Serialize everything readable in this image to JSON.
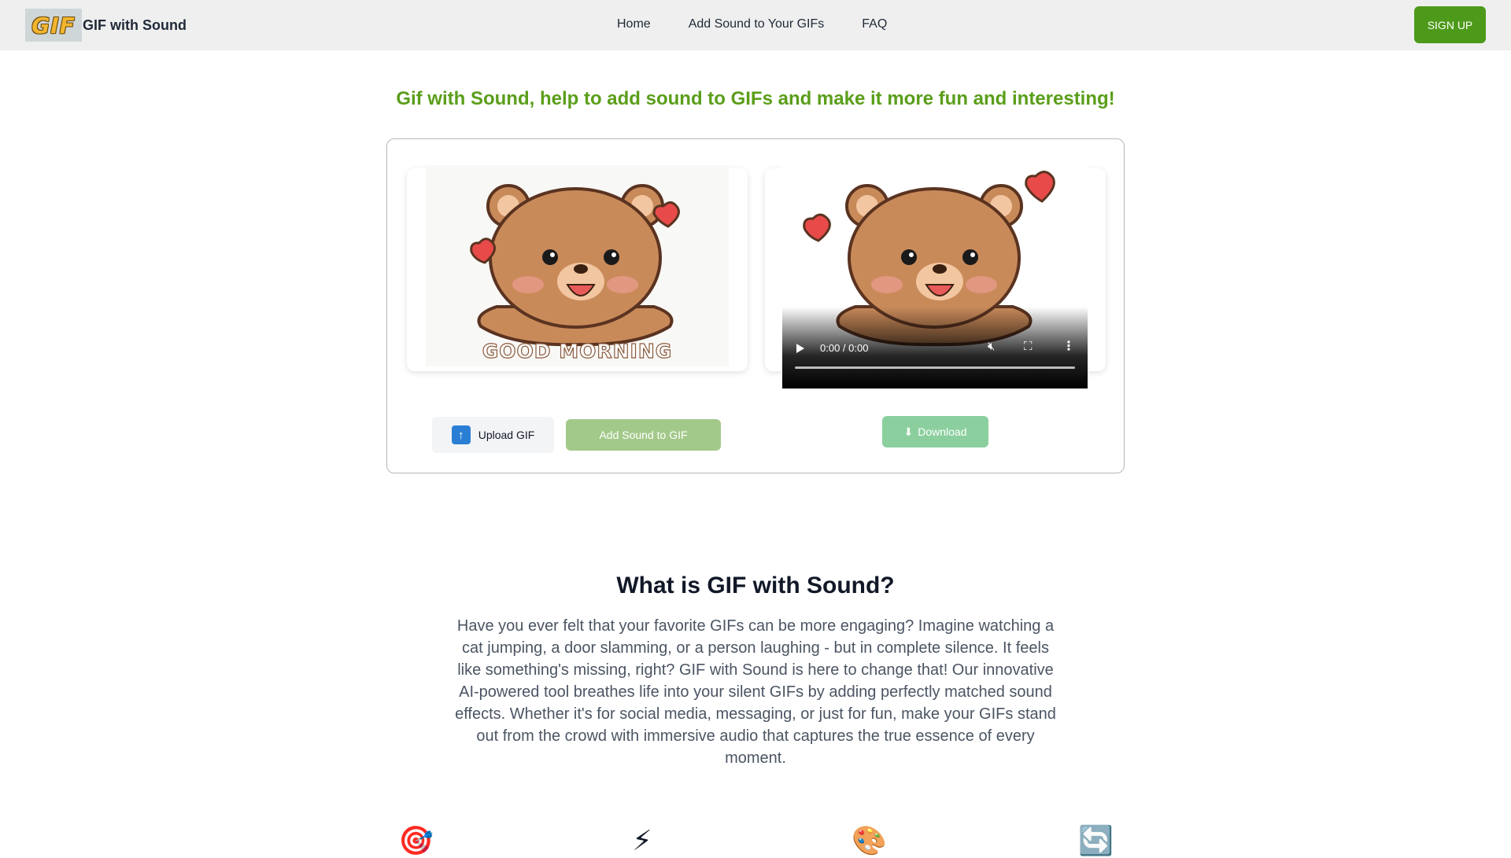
{
  "nav": {
    "logo_text": "GIF",
    "brand": "GIF with Sound",
    "links": [
      "Home",
      "Add Sound to Your GIFs",
      "FAQ"
    ],
    "signup": "SIGN UP"
  },
  "hero": {
    "title": "Gif with Sound, help to add sound to GIFs and make it more fun and interesting!"
  },
  "tool": {
    "preview_caption": "GOOD MORNING",
    "video_time": "0:00 / 0:00",
    "upload_label": "Upload GIF",
    "add_sound_label": "Add Sound to GIF",
    "download_label": "Download"
  },
  "about": {
    "title": "What is GIF with Sound?",
    "body": "Have you ever felt that your favorite GIFs can be more engaging? Imagine watching a cat jumping, a door slamming, or a person laughing - but in complete silence. It feels like something's missing, right? GIF with Sound is here to change that! Our innovative AI-powered tool breathes life into your silent GIFs by adding perfectly matched sound effects. Whether it's for social media, messaging, or just for fun, make your GIFs stand out from the crowd with immersive audio that captures the true essence of every moment."
  },
  "features": [
    {
      "icon": "target-icon",
      "glyph": "🎯"
    },
    {
      "icon": "lightning-icon",
      "glyph": "⚡"
    },
    {
      "icon": "palette-icon",
      "glyph": "🎨"
    },
    {
      "icon": "repeat-icon",
      "glyph": "🔄"
    }
  ],
  "colors": {
    "accent": "#4d9a1a",
    "hero_title": "#5a9e1a",
    "add_sound_btn": "#a3c98a",
    "download_btn": "#8bcf9e"
  }
}
